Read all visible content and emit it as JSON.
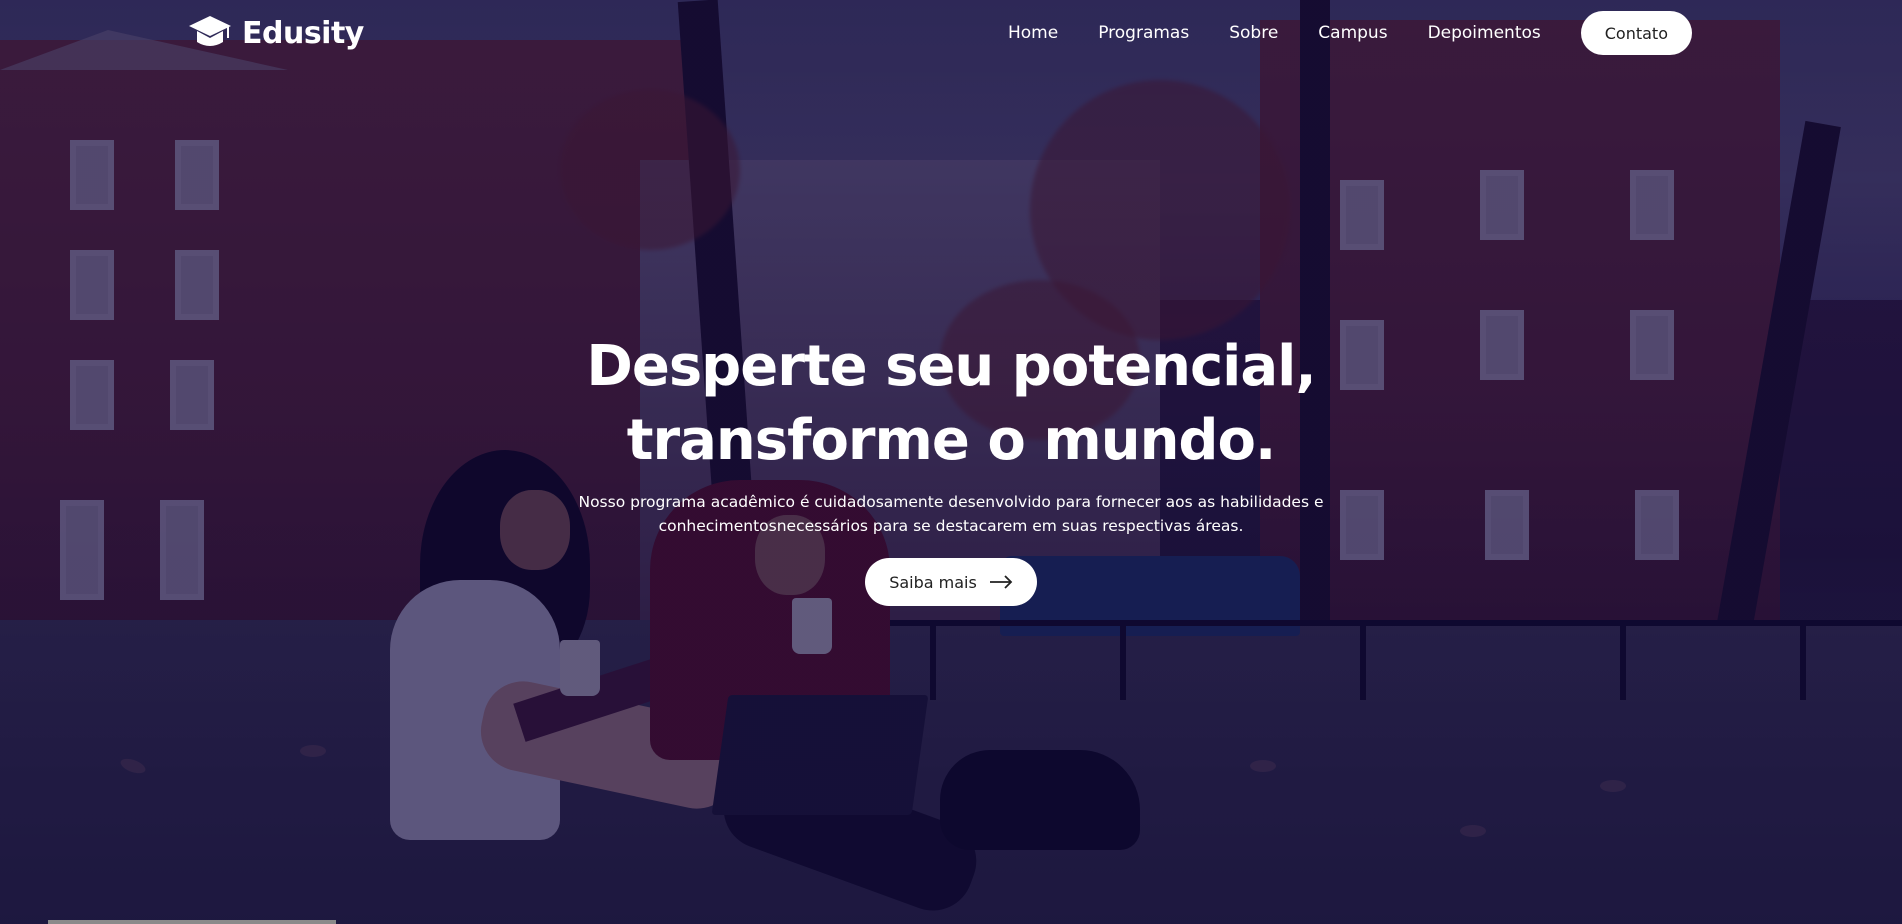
{
  "nav": {
    "brand": "Edusity",
    "links": [
      "Home",
      "Programas",
      "Sobre",
      "Campus",
      "Depoimentos"
    ],
    "contact_label": "Contato"
  },
  "hero": {
    "title_line1": "Desperte seu potencial,",
    "title_line2": "transforme o mundo.",
    "description": "Nosso programa acadêmico é cuidadosamente desenvolvido para fornecer aos as habilidades e conhecimentosnecessários para se destacarem em suas respectivas áreas.",
    "cta_label": "Saiba mais"
  },
  "icons": {
    "logo": "graduation-cap-icon",
    "cta_arrow": "arrow-right-icon"
  },
  "colors": {
    "overlay": "#08003a",
    "button_bg": "#ffffff",
    "button_text": "#212121",
    "nav_text": "#ffffff"
  }
}
